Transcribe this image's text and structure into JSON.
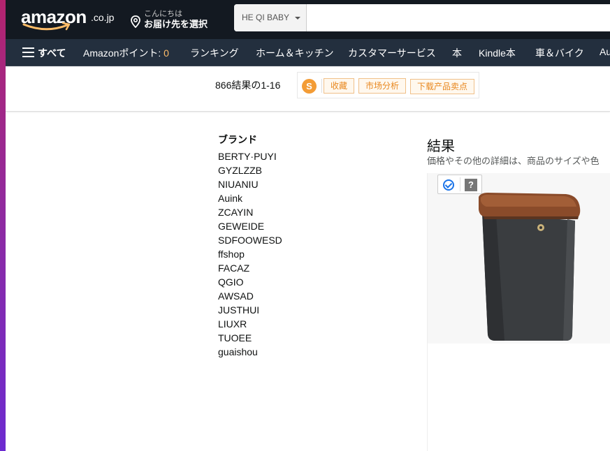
{
  "header": {
    "logo": "amazon",
    "logo_suffix": ".co.jp",
    "deliver_line1": "こんにちは",
    "deliver_line2": "お届け先を選択",
    "search_category": "HE QI BABY",
    "search_value": ""
  },
  "nav": {
    "all": "すべて",
    "points_label": "Amazonポイント: ",
    "points_value": "0",
    "ranking": "ランキング",
    "home_kitchen": "ホーム＆キッチン",
    "customer_service": "カスタマーサービス",
    "books": "本",
    "kindle": "Kindle本",
    "car_bike": "車＆バイク",
    "truncated": "Au"
  },
  "results_bar": {
    "count": "866結果の1-16",
    "ext_logo": "S",
    "collect": "收藏",
    "market_analysis": "市场分析",
    "download_selling_points": "下载产品卖点"
  },
  "filters": {
    "title": "ブランド",
    "brands": [
      "BERTY·PUYI",
      "GYZLZZB",
      "NIUANIU",
      "Auink",
      "ZCAYIN",
      "GEWEIDE",
      "SDFOOWESD",
      "ffshop",
      "FACAZ",
      "QGIO",
      "AWSAD",
      "JUSTHUI",
      "LIUXR",
      "TUOEE",
      "guaishou"
    ]
  },
  "results": {
    "title": "結果",
    "subtitle": "価格やその他の詳細は、商品のサイズや色",
    "card_help": "?"
  },
  "colors": {
    "nav_top": "#131921",
    "nav_sub": "#232f3e",
    "accent_orange": "#febd69",
    "ext_orange": "#e8871e"
  }
}
